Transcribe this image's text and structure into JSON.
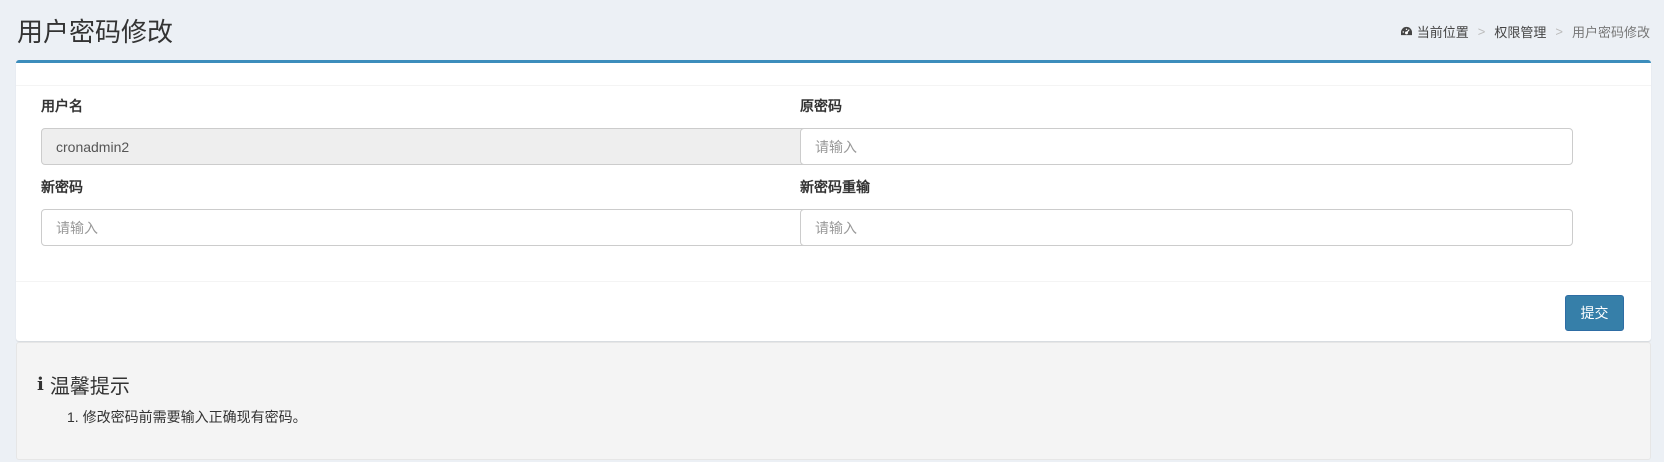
{
  "page": {
    "title": "用户密码修改"
  },
  "breadcrumb": {
    "home_label": "当前位置",
    "home_icon": "dashboard-icon",
    "section_label": "权限管理",
    "current_label": "用户密码修改",
    "separator": ">"
  },
  "form": {
    "username": {
      "label": "用户名",
      "value": "cronadmin2"
    },
    "old_password": {
      "label": "原密码",
      "placeholder": "请输入"
    },
    "new_password": {
      "label": "新密码",
      "placeholder": "请输入"
    },
    "confirm_password": {
      "label": "新密码重输",
      "placeholder": "请输入"
    },
    "submit_label": "提交"
  },
  "tips": {
    "icon": "info-icon",
    "title": "温馨提示",
    "items": [
      "1. 修改密码前需要输入正确现有密码。"
    ]
  },
  "colors": {
    "accent": "#3c8dbc",
    "button": "#367fa9",
    "background": "#ecf0f5"
  }
}
